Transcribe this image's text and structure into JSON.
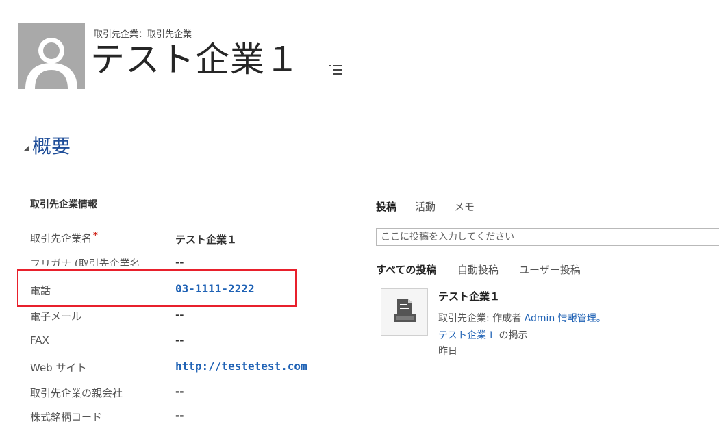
{
  "header": {
    "entity_type": "取引先企業：取引先企業",
    "record_title": "テスト企業１",
    "menu_icon": "list-menu-icon",
    "avatar_icon": "person-silhouette-icon"
  },
  "section": {
    "title": "概要",
    "toggle_icon": "collapse-triangle-icon"
  },
  "form": {
    "group_title": "取引先企業情報",
    "fields": [
      {
        "label": "取引先企業名",
        "required": "*",
        "value": "テスト企業１"
      },
      {
        "label": "フリガナ (取引先企業名",
        "value": "--"
      },
      {
        "label": "電話",
        "value": "03-1111-2222"
      },
      {
        "label": "電子メール",
        "value": "--"
      },
      {
        "label": "FAX",
        "value": "--"
      },
      {
        "label": "Web サイト",
        "value": "http://testetest.com"
      },
      {
        "label": "取引先企業の親会社",
        "value": "--"
      },
      {
        "label": "株式銘柄コード",
        "value": "--"
      }
    ]
  },
  "social": {
    "tabs": [
      "投稿",
      "活動",
      "メモ"
    ],
    "active_tab": "投稿",
    "post_placeholder": "ここに投稿を入力してください",
    "subtabs": [
      "すべての投稿",
      "自動投稿",
      "ユーザー投稿"
    ],
    "active_subtab": "すべての投稿",
    "post": {
      "icon": "document-post-icon",
      "title": "テスト企業１",
      "line1_prefix": "取引先企業: 作成者",
      "line1_link": "Admin 情報管理。",
      "line2_link": "テスト企業１",
      "line2_suffix": "の掲示",
      "time": "昨日"
    }
  },
  "colors": {
    "link": "#1f62b5",
    "section_title": "#1f4e99",
    "highlight": "#e8202c",
    "required": "#d0271d"
  }
}
